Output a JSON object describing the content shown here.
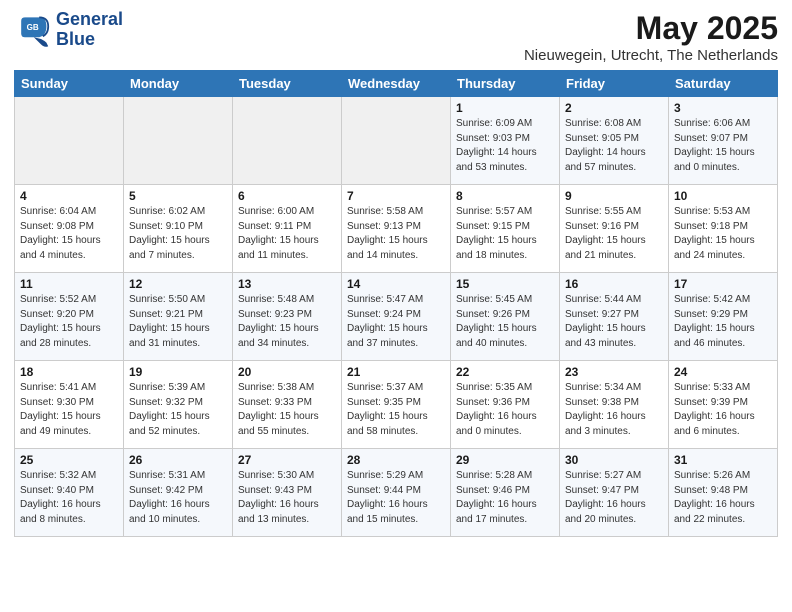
{
  "header": {
    "logo_line1": "General",
    "logo_line2": "Blue",
    "month_year": "May 2025",
    "location": "Nieuwegein, Utrecht, The Netherlands"
  },
  "weekdays": [
    "Sunday",
    "Monday",
    "Tuesday",
    "Wednesday",
    "Thursday",
    "Friday",
    "Saturday"
  ],
  "weeks": [
    [
      {
        "day": "",
        "info": ""
      },
      {
        "day": "",
        "info": ""
      },
      {
        "day": "",
        "info": ""
      },
      {
        "day": "",
        "info": ""
      },
      {
        "day": "1",
        "info": "Sunrise: 6:09 AM\nSunset: 9:03 PM\nDaylight: 14 hours\nand 53 minutes."
      },
      {
        "day": "2",
        "info": "Sunrise: 6:08 AM\nSunset: 9:05 PM\nDaylight: 14 hours\nand 57 minutes."
      },
      {
        "day": "3",
        "info": "Sunrise: 6:06 AM\nSunset: 9:07 PM\nDaylight: 15 hours\nand 0 minutes."
      }
    ],
    [
      {
        "day": "4",
        "info": "Sunrise: 6:04 AM\nSunset: 9:08 PM\nDaylight: 15 hours\nand 4 minutes."
      },
      {
        "day": "5",
        "info": "Sunrise: 6:02 AM\nSunset: 9:10 PM\nDaylight: 15 hours\nand 7 minutes."
      },
      {
        "day": "6",
        "info": "Sunrise: 6:00 AM\nSunset: 9:11 PM\nDaylight: 15 hours\nand 11 minutes."
      },
      {
        "day": "7",
        "info": "Sunrise: 5:58 AM\nSunset: 9:13 PM\nDaylight: 15 hours\nand 14 minutes."
      },
      {
        "day": "8",
        "info": "Sunrise: 5:57 AM\nSunset: 9:15 PM\nDaylight: 15 hours\nand 18 minutes."
      },
      {
        "day": "9",
        "info": "Sunrise: 5:55 AM\nSunset: 9:16 PM\nDaylight: 15 hours\nand 21 minutes."
      },
      {
        "day": "10",
        "info": "Sunrise: 5:53 AM\nSunset: 9:18 PM\nDaylight: 15 hours\nand 24 minutes."
      }
    ],
    [
      {
        "day": "11",
        "info": "Sunrise: 5:52 AM\nSunset: 9:20 PM\nDaylight: 15 hours\nand 28 minutes."
      },
      {
        "day": "12",
        "info": "Sunrise: 5:50 AM\nSunset: 9:21 PM\nDaylight: 15 hours\nand 31 minutes."
      },
      {
        "day": "13",
        "info": "Sunrise: 5:48 AM\nSunset: 9:23 PM\nDaylight: 15 hours\nand 34 minutes."
      },
      {
        "day": "14",
        "info": "Sunrise: 5:47 AM\nSunset: 9:24 PM\nDaylight: 15 hours\nand 37 minutes."
      },
      {
        "day": "15",
        "info": "Sunrise: 5:45 AM\nSunset: 9:26 PM\nDaylight: 15 hours\nand 40 minutes."
      },
      {
        "day": "16",
        "info": "Sunrise: 5:44 AM\nSunset: 9:27 PM\nDaylight: 15 hours\nand 43 minutes."
      },
      {
        "day": "17",
        "info": "Sunrise: 5:42 AM\nSunset: 9:29 PM\nDaylight: 15 hours\nand 46 minutes."
      }
    ],
    [
      {
        "day": "18",
        "info": "Sunrise: 5:41 AM\nSunset: 9:30 PM\nDaylight: 15 hours\nand 49 minutes."
      },
      {
        "day": "19",
        "info": "Sunrise: 5:39 AM\nSunset: 9:32 PM\nDaylight: 15 hours\nand 52 minutes."
      },
      {
        "day": "20",
        "info": "Sunrise: 5:38 AM\nSunset: 9:33 PM\nDaylight: 15 hours\nand 55 minutes."
      },
      {
        "day": "21",
        "info": "Sunrise: 5:37 AM\nSunset: 9:35 PM\nDaylight: 15 hours\nand 58 minutes."
      },
      {
        "day": "22",
        "info": "Sunrise: 5:35 AM\nSunset: 9:36 PM\nDaylight: 16 hours\nand 0 minutes."
      },
      {
        "day": "23",
        "info": "Sunrise: 5:34 AM\nSunset: 9:38 PM\nDaylight: 16 hours\nand 3 minutes."
      },
      {
        "day": "24",
        "info": "Sunrise: 5:33 AM\nSunset: 9:39 PM\nDaylight: 16 hours\nand 6 minutes."
      }
    ],
    [
      {
        "day": "25",
        "info": "Sunrise: 5:32 AM\nSunset: 9:40 PM\nDaylight: 16 hours\nand 8 minutes."
      },
      {
        "day": "26",
        "info": "Sunrise: 5:31 AM\nSunset: 9:42 PM\nDaylight: 16 hours\nand 10 minutes."
      },
      {
        "day": "27",
        "info": "Sunrise: 5:30 AM\nSunset: 9:43 PM\nDaylight: 16 hours\nand 13 minutes."
      },
      {
        "day": "28",
        "info": "Sunrise: 5:29 AM\nSunset: 9:44 PM\nDaylight: 16 hours\nand 15 minutes."
      },
      {
        "day": "29",
        "info": "Sunrise: 5:28 AM\nSunset: 9:46 PM\nDaylight: 16 hours\nand 17 minutes."
      },
      {
        "day": "30",
        "info": "Sunrise: 5:27 AM\nSunset: 9:47 PM\nDaylight: 16 hours\nand 20 minutes."
      },
      {
        "day": "31",
        "info": "Sunrise: 5:26 AM\nSunset: 9:48 PM\nDaylight: 16 hours\nand 22 minutes."
      }
    ]
  ]
}
